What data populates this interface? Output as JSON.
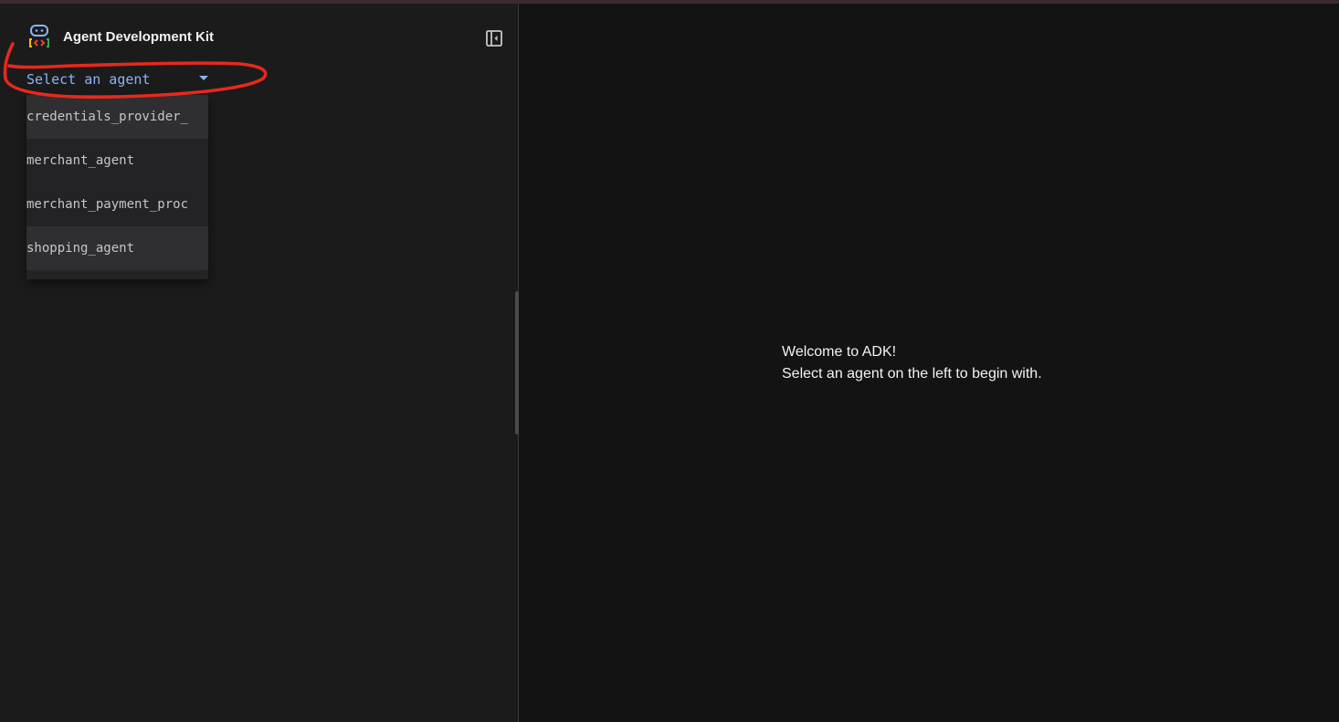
{
  "app": {
    "title": "Agent Development Kit"
  },
  "sidebar": {
    "collapse_icon": "sidebar-collapse-icon",
    "agent_select": {
      "label": "Select an agent",
      "arrow_icon": "dropdown-arrow-icon"
    },
    "agent_options": [
      "credentials_provider_",
      "merchant_agent",
      "merchant_payment_proc",
      "shopping_agent"
    ]
  },
  "main": {
    "welcome_line1": "Welcome to ADK!",
    "welcome_line2": "Select an agent on the left to begin with."
  },
  "colors": {
    "accent": "#8ab4f8",
    "annotation": "#e8281e",
    "sidebar_bg": "#1b1b1c",
    "main_bg": "#131314"
  }
}
